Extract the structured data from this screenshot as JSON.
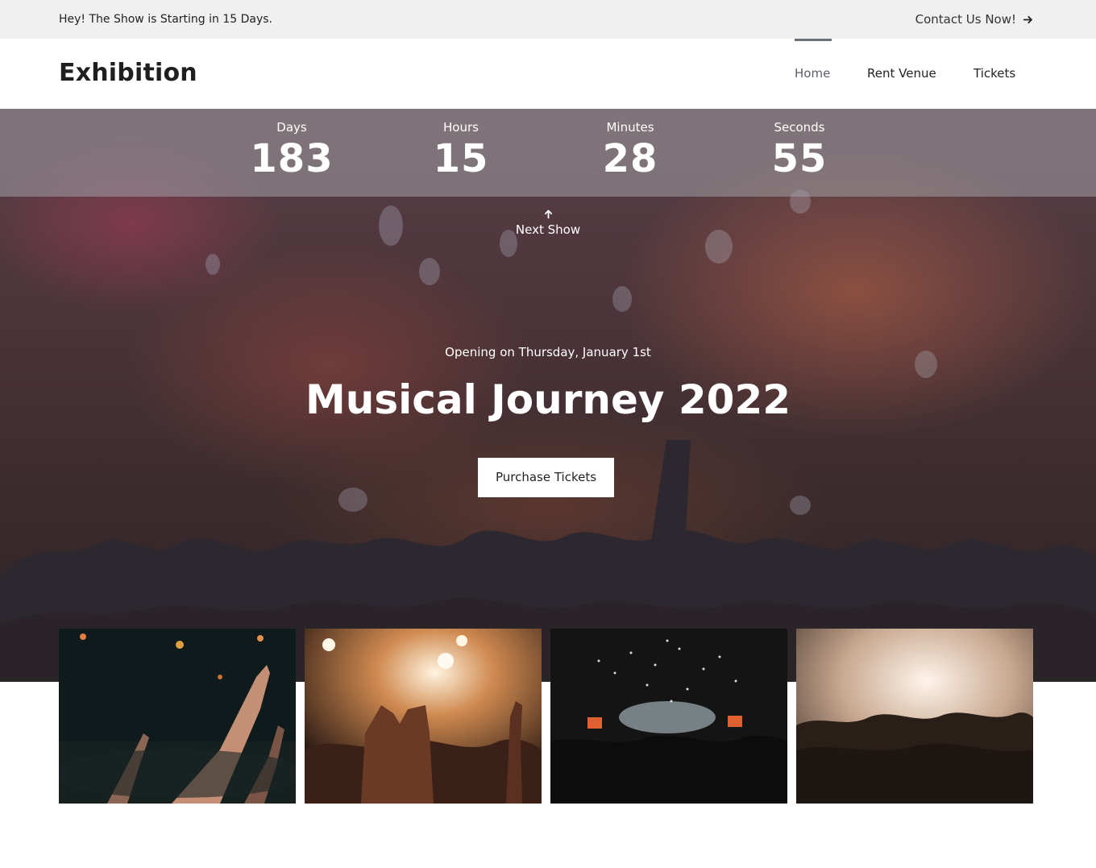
{
  "topbar": {
    "announcement": "Hey! The Show is Starting in 15 Days.",
    "contact_label": "Contact Us Now!",
    "contact_icon": "arrow-right-icon"
  },
  "navbar": {
    "logo": "Exhibition",
    "items": [
      {
        "label": "Home",
        "active": true
      },
      {
        "label": "Rent Venue",
        "active": false
      },
      {
        "label": "Tickets",
        "active": false
      }
    ]
  },
  "countdown": {
    "days_label": "Days",
    "days_value": "183",
    "hours_label": "Hours",
    "hours_value": "15",
    "minutes_label": "Minutes",
    "minutes_value": "28",
    "seconds_label": "Seconds",
    "seconds_value": "55"
  },
  "hero": {
    "next_show_label": "Next Show",
    "next_show_icon": "arrow-up-icon",
    "opening_text": "Opening on Thursday, January 1st",
    "title": "Musical Journey 2022",
    "button_label": "Purchase Tickets"
  },
  "gallery": [
    {
      "name": "concert-hands-photo"
    },
    {
      "name": "heart-hands-stage-photo"
    },
    {
      "name": "confetti-crowd-photo"
    },
    {
      "name": "stage-lights-crowd-photo"
    }
  ],
  "colors": {
    "topbar_bg": "#f0f0f0",
    "hero_dark": "#2a2428",
    "accent_gray": "#6b6f76"
  }
}
